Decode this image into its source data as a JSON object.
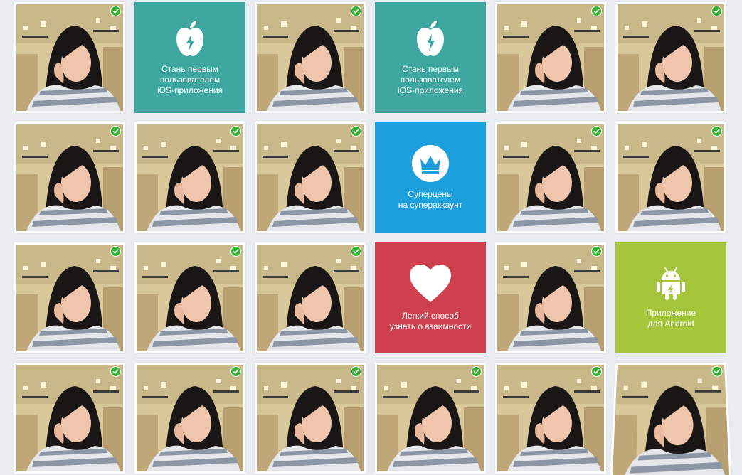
{
  "colors": {
    "ios": "#3ea8a0",
    "super": "#1c9fdd",
    "match": "#d0414f",
    "android": "#a4c43a",
    "verified": "#34b233",
    "background": "#e9edf2"
  },
  "promos": {
    "ios_1": {
      "icon": "apple-icon",
      "text": "Стань первым\nпользователем\niOS-приложения"
    },
    "ios_2": {
      "icon": "apple-icon",
      "text": "Стань первым\nпользователем\niOS-приложения"
    },
    "superprice": {
      "icon": "crown-icon",
      "text": "Суперцены\nна супераккаунт"
    },
    "match": {
      "icon": "heart-icon",
      "text": "Легкий способ\nузнать о взаимности"
    },
    "android": {
      "icon": "android-icon",
      "text": "Приложение\nдля Android"
    }
  },
  "grid": [
    [
      "photo",
      "promo:ios_1",
      "photo",
      "promo:ios_2",
      "photo",
      "photo"
    ],
    [
      "photo",
      "photo",
      "photo",
      "promo:superprice",
      "photo",
      "photo"
    ],
    [
      "photo",
      "photo",
      "photo",
      "promo:match",
      "photo",
      "promo:android"
    ],
    [
      "photo",
      "photo",
      "photo",
      "photo",
      "photo",
      "photo"
    ]
  ]
}
